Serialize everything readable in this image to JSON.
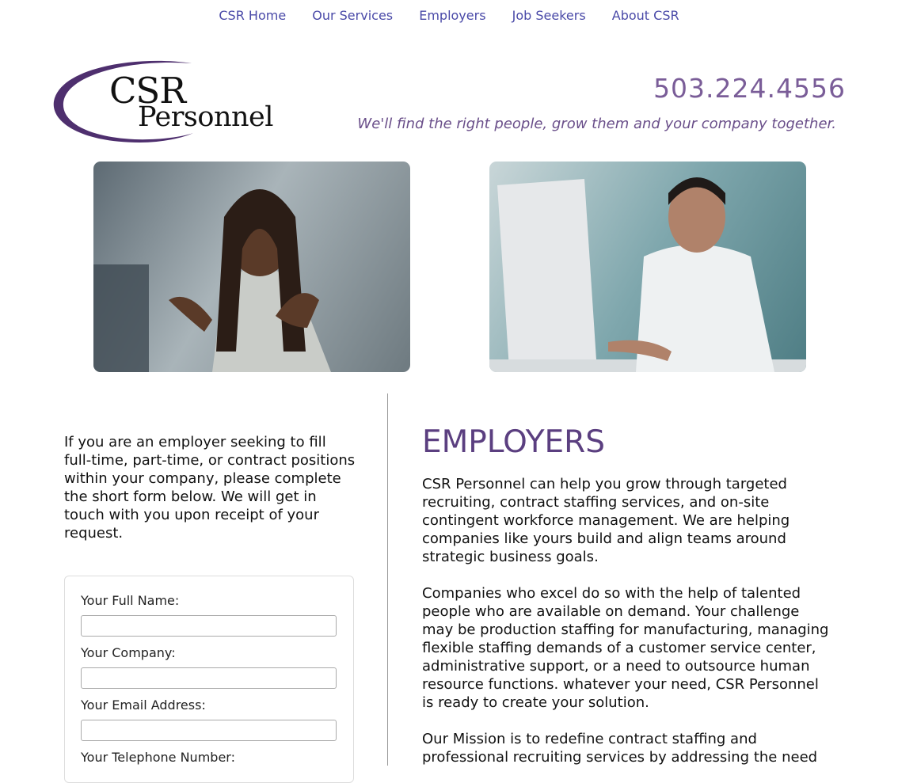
{
  "nav": {
    "items": [
      "CSR Home",
      "Our Services",
      "Employers",
      "Job Seekers",
      "About CSR"
    ]
  },
  "header": {
    "logo_line1": "CSR",
    "logo_line2": "Personnel",
    "phone": "503.224.4556",
    "tagline": "We'll find the right people, grow them and your company together."
  },
  "photos": {
    "left": "woman-headset-photo",
    "right": "man-headset-computer-photo"
  },
  "left": {
    "intro": "If you are an employer seeking to fill full-time, part-time, or contract positions within your company, please complete the short form below. We will get in touch with you upon receipt of your request.",
    "form": {
      "name_label": "Your Full Name:",
      "company_label": "Your Company:",
      "email_label": "Your Email Address:",
      "phone_label": "Your Telephone Number:"
    }
  },
  "main": {
    "heading": "EMPLOYERS",
    "p1": "CSR Personnel can help you grow through targeted recruiting, contract staffing services, and on-site contingent workforce management. We are helping companies like yours build and align teams around strategic business goals.",
    "p2": "Companies who excel do so with the help of talented people who are available on demand. Your challenge may be production staffing for manufacturing, managing flexible staffing demands of a customer service center, administrative support, or a need to outsource human resource functions. whatever your need, CSR Personnel is ready to create your solution.",
    "p3": "Our Mission is to redefine contract staffing and professional recruiting services by addressing the need"
  },
  "colors": {
    "accent": "#5b3f80",
    "nav_link": "#4a4aa8"
  }
}
